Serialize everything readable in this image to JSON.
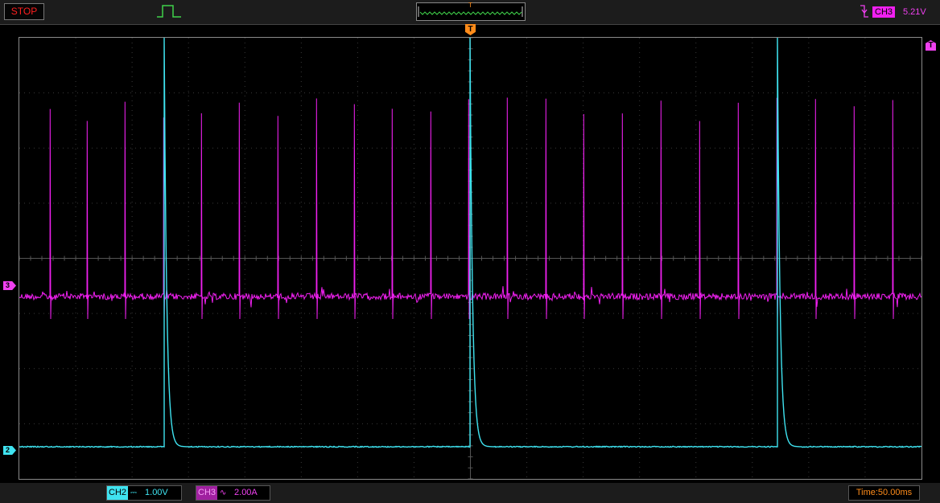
{
  "toolbar": {
    "status": "STOP",
    "pulse_icon": "single-pulse-icon"
  },
  "trigger": {
    "marker": "T",
    "edge_icon": "falling-edge-icon",
    "source": "CH3",
    "level": "5.21V",
    "level_marker": "T"
  },
  "channels": {
    "ch3": {
      "label": "CH3",
      "marker": "3",
      "coupling": "ac-coupling-icon",
      "coupling_glyph": "∿",
      "scale": "2.00A",
      "color": "#f040f0"
    },
    "ch2": {
      "label": "CH2",
      "marker": "2",
      "coupling": "dc-coupling-icon",
      "coupling_glyph": "⎓",
      "scale": "1.00V",
      "color": "#3fe3f0"
    }
  },
  "timebase": {
    "text": "Time:50.00ms"
  },
  "colors": {
    "trigger": "#ff8c1a",
    "status_stop": "#ff1f1f",
    "grid": "#8a8a8a"
  }
}
